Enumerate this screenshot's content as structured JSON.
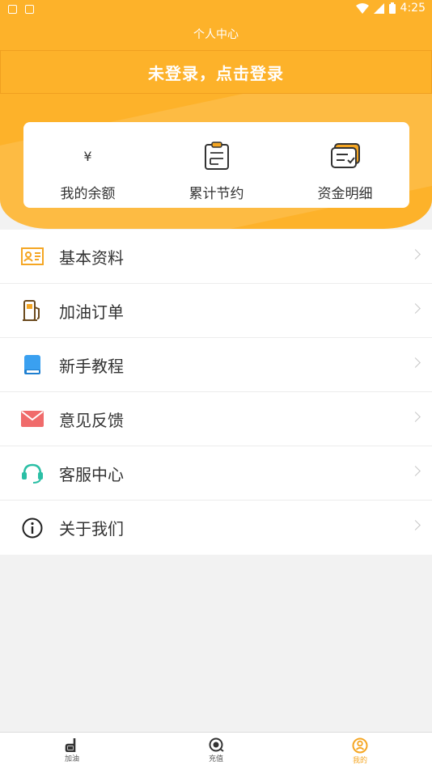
{
  "status": {
    "time": "4:25"
  },
  "header": {
    "title": "个人中心",
    "login": "未登录，点击登录"
  },
  "stats": [
    {
      "label": "我的余额",
      "icon": "yen-icon",
      "symbol": "¥"
    },
    {
      "label": "累计节约",
      "icon": "clipboard-icon"
    },
    {
      "label": "资金明细",
      "icon": "wallet-list-icon"
    }
  ],
  "menu": [
    {
      "label": "基本资料",
      "icon": "id-card-icon",
      "color": "#f5a623"
    },
    {
      "label": "加油订单",
      "icon": "fuel-pump-icon",
      "color": "#6b4a1e"
    },
    {
      "label": "新手教程",
      "icon": "book-icon",
      "color": "#3aa0f0"
    },
    {
      "label": "意见反馈",
      "icon": "mail-icon",
      "color": "#f06b6b"
    },
    {
      "label": "客服中心",
      "icon": "headset-icon",
      "color": "#2bbfa5"
    },
    {
      "label": "关于我们",
      "icon": "info-icon",
      "color": "#222222"
    }
  ],
  "tabs": [
    {
      "label": "加油",
      "icon": "fuel-tab-icon"
    },
    {
      "label": "充值",
      "icon": "recharge-tab-icon"
    },
    {
      "label": "我的",
      "icon": "user-tab-icon",
      "active": true
    }
  ],
  "colors": {
    "primary": "#fdb22a",
    "accent": "#f5a623"
  }
}
